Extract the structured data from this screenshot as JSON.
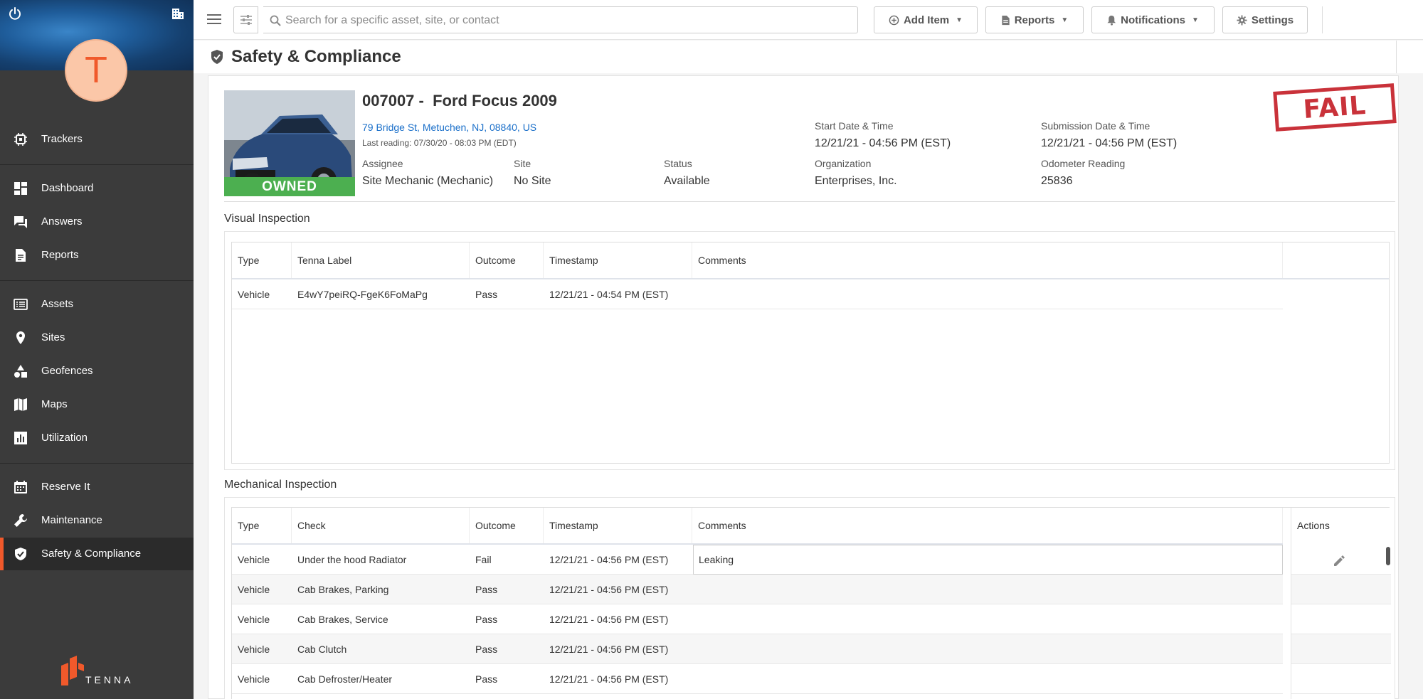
{
  "sidebar": {
    "avatar_initial": "T",
    "brand": "TENNA",
    "items": [
      {
        "label": "Trackers"
      },
      {
        "label": "Dashboard"
      },
      {
        "label": "Answers"
      },
      {
        "label": "Reports"
      },
      {
        "label": "Assets"
      },
      {
        "label": "Sites"
      },
      {
        "label": "Geofences"
      },
      {
        "label": "Maps"
      },
      {
        "label": "Utilization"
      },
      {
        "label": "Reserve It"
      },
      {
        "label": "Maintenance"
      },
      {
        "label": "Safety & Compliance"
      }
    ],
    "accent_color": "#f0592b"
  },
  "topbar": {
    "search_placeholder": "Search for a specific asset, site, or contact",
    "add_item": "Add Item",
    "reports": "Reports",
    "notifications": "Notifications",
    "settings": "Settings"
  },
  "page": {
    "title": "Safety & Compliance"
  },
  "asset": {
    "title": "007007 -  Ford Focus 2009",
    "address": "79 Bridge St, Metuchen, NJ, 08840, US",
    "last_reading": "Last reading: 07/30/20 - 08:03 PM (EDT)",
    "badge": "OWNED",
    "result_stamp": "FAIL",
    "fields": {
      "assignee_label": "Assignee",
      "assignee_value": "Site Mechanic (Mechanic)",
      "site_label": "Site",
      "site_value": "No Site",
      "status_label": "Status",
      "status_value": "Available",
      "start_label": "Start Date & Time",
      "start_value": "12/21/21 - 04:56 PM (EST)",
      "org_label": "Organization",
      "org_value": "Enterprises, Inc.",
      "submission_label": "Submission Date & Time",
      "submission_value": "12/21/21 - 04:56 PM (EST)",
      "odometer_label": "Odometer Reading",
      "odometer_value": "25836"
    }
  },
  "visual_inspection": {
    "title": "Visual Inspection",
    "columns": [
      "Type",
      "Tenna Label",
      "Outcome",
      "Timestamp",
      "Comments"
    ],
    "rows": [
      {
        "type": "Vehicle",
        "label": "E4wY7peiRQ-FgeK6FoMaPg",
        "outcome": "Pass",
        "timestamp": "12/21/21 - 04:54 PM (EST)",
        "comments": ""
      }
    ]
  },
  "mechanical_inspection": {
    "title": "Mechanical Inspection",
    "columns": [
      "Type",
      "Check",
      "Outcome",
      "Timestamp",
      "Comments"
    ],
    "actions_label": "Actions",
    "rows": [
      {
        "type": "Vehicle",
        "check": "Under the hood Radiator",
        "outcome": "Fail",
        "timestamp": "12/21/21 - 04:56 PM (EST)",
        "comments": "Leaking"
      },
      {
        "type": "Vehicle",
        "check": "Cab Brakes, Parking",
        "outcome": "Pass",
        "timestamp": "12/21/21 - 04:56 PM (EST)",
        "comments": ""
      },
      {
        "type": "Vehicle",
        "check": "Cab Brakes, Service",
        "outcome": "Pass",
        "timestamp": "12/21/21 - 04:56 PM (EST)",
        "comments": ""
      },
      {
        "type": "Vehicle",
        "check": "Cab Clutch",
        "outcome": "Pass",
        "timestamp": "12/21/21 - 04:56 PM (EST)",
        "comments": ""
      },
      {
        "type": "Vehicle",
        "check": "Cab Defroster/Heater",
        "outcome": "Pass",
        "timestamp": "12/21/21 - 04:56 PM (EST)",
        "comments": ""
      }
    ]
  }
}
